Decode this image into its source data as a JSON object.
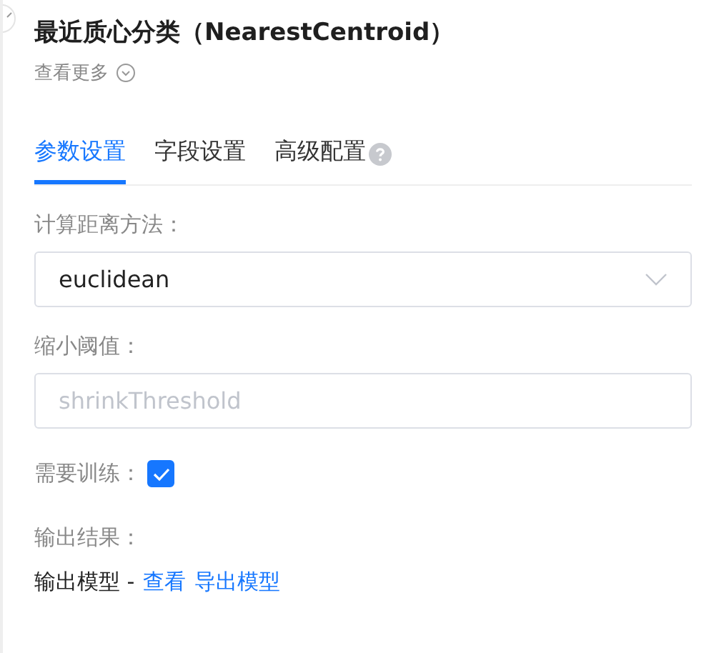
{
  "title": "最近质心分类（NearestCentroid）",
  "more": "查看更多",
  "tabs": [
    {
      "label": "参数设置",
      "selected": true,
      "help": false
    },
    {
      "label": "字段设置",
      "selected": false,
      "help": false
    },
    {
      "label": "高级配置",
      "selected": false,
      "help": true
    }
  ],
  "fields": [
    {
      "kind": "select",
      "label": "计算距离方法：",
      "value": "euclidean"
    },
    {
      "kind": "input",
      "label": "缩小阈值：",
      "placeholder": "shrinkThreshold"
    },
    {
      "kind": "checkbox",
      "label": "需要训练：",
      "checked": true
    },
    {
      "kind": "output",
      "label": "输出结果：",
      "text": "输出模型 -",
      "links": [
        "查看",
        "导出模型"
      ]
    }
  ]
}
